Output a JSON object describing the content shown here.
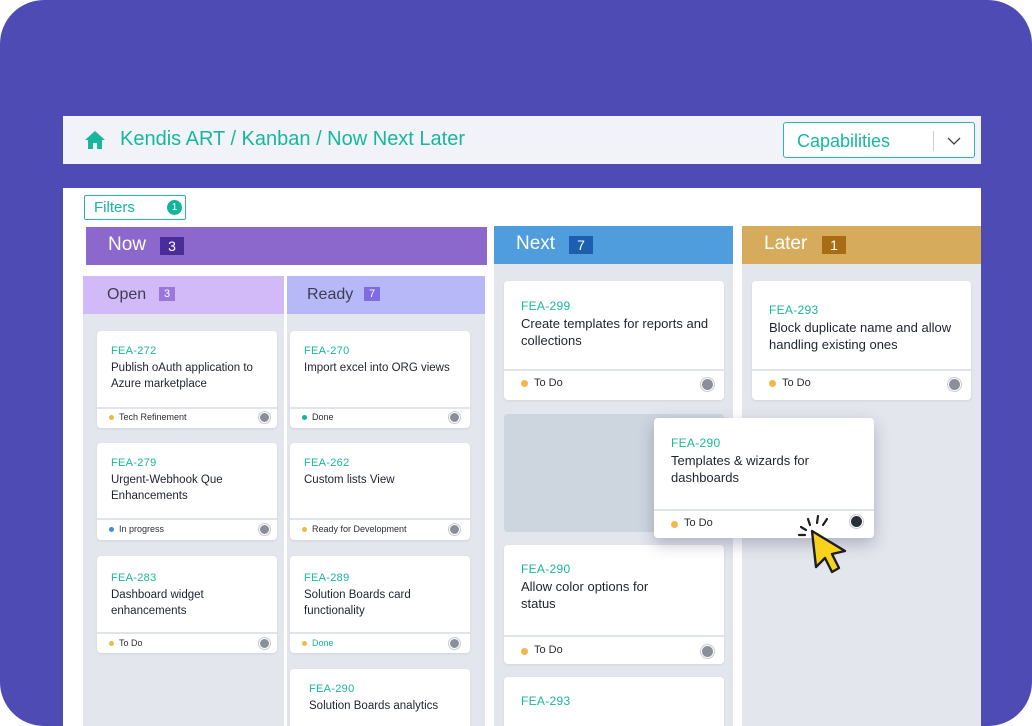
{
  "breadcrumb": "Kendis ART / Kanban / Now Next Later",
  "selector": {
    "value": "Capabilities"
  },
  "filters": {
    "label": "Filters",
    "count": "1"
  },
  "colors": {
    "accent": "#17b79d",
    "now": "#8c67cc",
    "next": "#4f9ddc",
    "later": "#d6ab5b",
    "background": "#4e4cb4"
  },
  "columns": {
    "now": {
      "title": "Now",
      "count": "3"
    },
    "next": {
      "title": "Next",
      "count": "7"
    },
    "later": {
      "title": "Later",
      "count": "1"
    }
  },
  "subcolumns": {
    "open": {
      "title": "Open",
      "count": "3"
    },
    "ready": {
      "title": "Ready",
      "count": "7"
    }
  },
  "cards": {
    "open": [
      {
        "id": "FEA-272",
        "title": "Publish oAuth application to Azure marketplace",
        "status": "Tech Refinement",
        "status_color": "#f0b74a"
      },
      {
        "id": "FEA-279",
        "title": "Urgent-Webhook Que Enhancements",
        "status": "In progress",
        "status_color": "#3b8fe0"
      },
      {
        "id": "FEA-283",
        "title": "Dashboard widget enhancements",
        "status": "To Do",
        "status_color": "#f0b74a"
      }
    ],
    "ready": [
      {
        "id": "FEA-270",
        "title": "Import excel into ORG views",
        "status": "Done",
        "status_color": "#13b59a"
      },
      {
        "id": "FEA-262",
        "title": "Custom lists View",
        "status": "Ready for Development",
        "status_color": "#f0b74a"
      },
      {
        "id": "FEA-289",
        "title": "Solution Boards card functionality",
        "status": "Done",
        "status_color": "#f0b74a"
      },
      {
        "id": "FEA-290",
        "title": "Solution Boards analytics"
      }
    ],
    "next": [
      {
        "id": "FEA-299",
        "title": "Create templates for reports and collections",
        "status": "To Do",
        "status_color": "#f0b74a"
      },
      {
        "id": "FEA-290",
        "title": "Allow color options for status",
        "status": "To Do",
        "status_color": "#f0b74a"
      },
      {
        "id": "FEA-293",
        "title": ""
      }
    ],
    "later": [
      {
        "id": "FEA-293",
        "title": "Block duplicate name and allow handling existing ones",
        "status": "To Do",
        "status_color": "#f0b74a"
      }
    ],
    "dragging": {
      "id": "FEA-290",
      "title": "Templates & wizards for dashboards",
      "status": "To Do",
      "status_color": "#f0b74a"
    }
  }
}
